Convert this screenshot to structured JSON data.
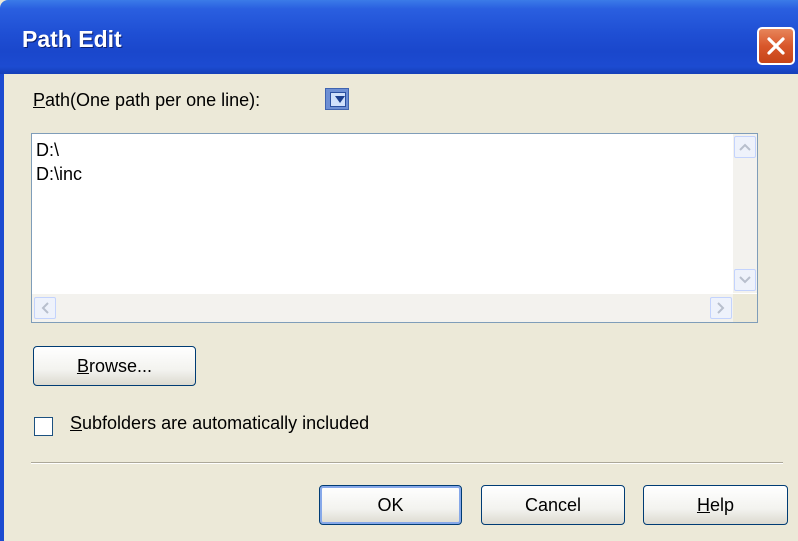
{
  "window": {
    "title": "Path Edit"
  },
  "path": {
    "label_prefix": "P",
    "label_rest": "ath(One path per one line):",
    "content": "D:\\\nD:\\inc"
  },
  "browse": {
    "mnemonic": "B",
    "rest": "rowse..."
  },
  "subfolders": {
    "mnemonic": "S",
    "rest": "ubfolders are automatically included",
    "checked": false
  },
  "buttons": {
    "ok": "OK",
    "cancel": "Cancel",
    "help_mnemonic": "H",
    "help_rest": "elp"
  },
  "icons": {
    "close": "close-icon",
    "path_insert": "folder-insert-icon",
    "scroll_up": "chevron-up-icon",
    "scroll_down": "chevron-down-icon",
    "scroll_left": "chevron-left-icon",
    "scroll_right": "chevron-right-icon"
  },
  "colors": {
    "titlebar": "#1f4fd4",
    "close_button": "#d9572b",
    "dialog_background": "#ece9d8"
  }
}
